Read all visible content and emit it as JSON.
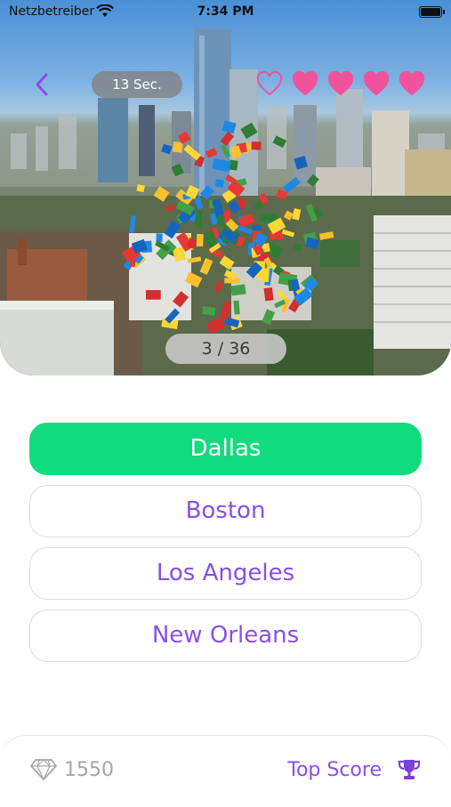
{
  "status_bar": {
    "carrier": "Netzbetreiber",
    "time": "7:34 PM"
  },
  "quiz": {
    "timer": "13 Sec.",
    "progress": "3 / 36",
    "lives": {
      "total": 5,
      "remaining": 4
    },
    "accent_color": "#8a4fe8",
    "heart_color": "#f0529c",
    "correct_color": "#10dc7d"
  },
  "answers": [
    {
      "label": "Dallas",
      "state": "correct"
    },
    {
      "label": "Boston",
      "state": "neutral"
    },
    {
      "label": "Los Angeles",
      "state": "neutral"
    },
    {
      "label": "New Orleans",
      "state": "neutral"
    }
  ],
  "footer": {
    "gems": "1550",
    "top_score_label": "Top Score",
    "gem_icon": "diamond-icon",
    "trophy_icon": "trophy-icon"
  }
}
